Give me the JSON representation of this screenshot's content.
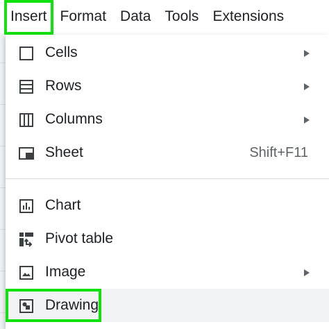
{
  "menubar": {
    "items": [
      {
        "label": "Insert"
      },
      {
        "label": "Format"
      },
      {
        "label": "Data"
      },
      {
        "label": "Tools"
      },
      {
        "label": "Extensions"
      }
    ]
  },
  "insert_menu": {
    "items": [
      {
        "label": "Cells",
        "icon": "square-outline-icon",
        "submenu": true
      },
      {
        "label": "Rows",
        "icon": "rows-icon",
        "submenu": true
      },
      {
        "label": "Columns",
        "icon": "columns-icon",
        "submenu": true
      },
      {
        "label": "Sheet",
        "icon": "sheet-icon",
        "shortcut": "Shift+F11"
      },
      {
        "label": "Chart",
        "icon": "chart-icon"
      },
      {
        "label": "Pivot table",
        "icon": "pivot-table-icon"
      },
      {
        "label": "Image",
        "icon": "image-icon",
        "submenu": true
      },
      {
        "label": "Drawing",
        "icon": "drawing-icon",
        "hovered": true
      }
    ]
  },
  "colors": {
    "highlight": "#11e10d",
    "text": "#202124",
    "icon": "#3c4043",
    "muted": "#5f6368",
    "hover_bg": "#f1f3f4"
  }
}
